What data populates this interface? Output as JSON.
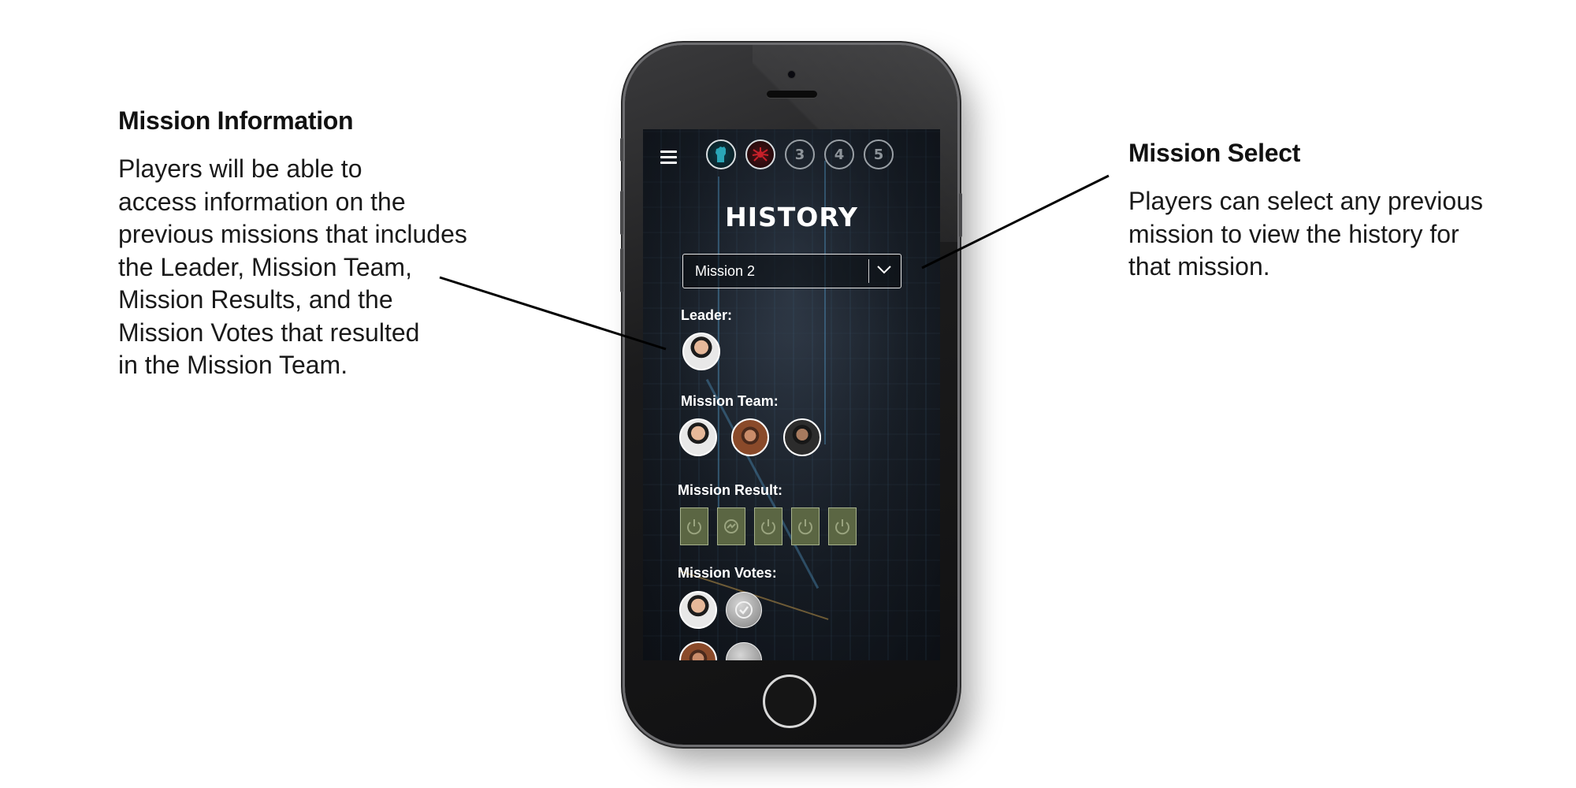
{
  "annotations": {
    "mission_info": {
      "title": "Mission Information",
      "lines": [
        "Players will be able to",
        "access information on the",
        "previous missions that includes",
        "the Leader, Mission Team,",
        "Mission Results, and the",
        "Mission Votes that resulted",
        "in the Mission Team."
      ]
    },
    "mission_select": {
      "title": "Mission Select",
      "lines": [
        "Players can select any previous",
        "mission to view the history for",
        "that mission."
      ]
    }
  },
  "app": {
    "mission_tabs": [
      {
        "label": "",
        "icon": "fist-icon",
        "status": "resistance-win",
        "color": "#2aa7b8"
      },
      {
        "label": "",
        "icon": "spider-icon",
        "status": "spy-win",
        "color": "#c8202a"
      },
      {
        "label": "3",
        "status": "pending"
      },
      {
        "label": "4",
        "status": "pending"
      },
      {
        "label": "5",
        "status": "pending"
      }
    ],
    "title": "HISTORY",
    "mission_select": {
      "selected": "Mission 2"
    },
    "sections": {
      "leader": "Leader:",
      "team": "Mission Team:",
      "result": "Mission Result:",
      "votes": "Mission Votes:"
    },
    "mission_result_cards": [
      "power-icon",
      "broken-icon",
      "power-icon",
      "power-icon",
      "power-icon"
    ],
    "accent_card_color": "#5b6643"
  }
}
